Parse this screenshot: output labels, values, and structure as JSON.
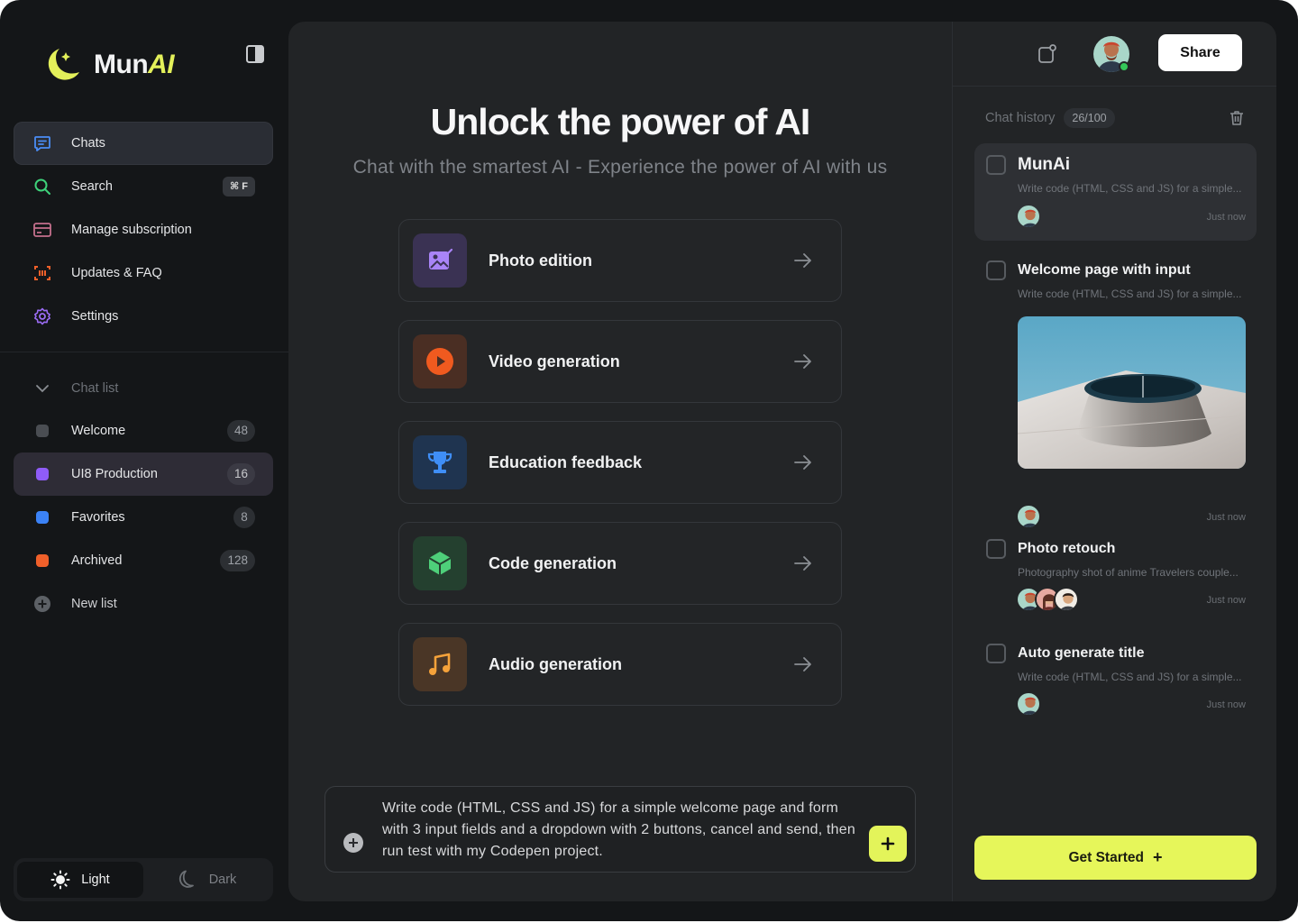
{
  "brand": {
    "name": "Mun",
    "name_accent": "AI"
  },
  "nav": {
    "items": [
      {
        "label": "Chats",
        "icon": "chat-icon",
        "active": true
      },
      {
        "label": "Search",
        "icon": "search-icon",
        "shortcut": "⌘ F"
      },
      {
        "label": "Manage subscription",
        "icon": "card-icon"
      },
      {
        "label": "Updates & FAQ",
        "icon": "scan-icon"
      },
      {
        "label": "Settings",
        "icon": "gear-icon"
      }
    ]
  },
  "lists": {
    "header": "Chat list",
    "items": [
      {
        "label": "Welcome",
        "count": "48",
        "color": "#4a4d52"
      },
      {
        "label": "UI8 Production",
        "count": "16",
        "color": "#8f5cf7",
        "active": true
      },
      {
        "label": "Favorites",
        "count": "8",
        "color": "#3b82f6"
      },
      {
        "label": "Archived",
        "count": "128",
        "color": "#f0602a"
      }
    ],
    "new_list": "New list"
  },
  "theme": {
    "light": "Light",
    "dark": "Dark",
    "selected": "Light"
  },
  "hero": {
    "title": "Unlock the power of AI",
    "subtitle": "Chat with the smartest AI - Experience the power of AI with us"
  },
  "cards": [
    {
      "label": "Photo edition",
      "icon": "photo-edit-icon",
      "bg": "#3a3253",
      "fg": "#a984f7"
    },
    {
      "label": "Video generation",
      "icon": "play-icon",
      "bg": "#4a2e23",
      "fg": "#f05a1f"
    },
    {
      "label": "Education feedback",
      "icon": "trophy-icon",
      "bg": "#1f3450",
      "fg": "#3f8ef7"
    },
    {
      "label": "Code generation",
      "icon": "cube-icon",
      "bg": "#24402f",
      "fg": "#4ed07a"
    },
    {
      "label": "Audio generation",
      "icon": "music-icon",
      "bg": "#4a3626",
      "fg": "#f5a23a"
    }
  ],
  "composer": {
    "text": "Write code (HTML, CSS and JS) for a simple welcome page and form with 3 input fields and a dropdown with 2 buttons, cancel and send, then run test with my Codepen project."
  },
  "topbar": {
    "share": "Share"
  },
  "history": {
    "label": "Chat history",
    "count": "26/100",
    "items": [
      {
        "title": "MunAi",
        "desc": "Write code (HTML, CSS and JS) for a simple...",
        "time": "Just now",
        "active": true
      },
      {
        "title": "Welcome page with input",
        "desc": "Write code (HTML, CSS and JS) for a simple...",
        "time": "Just now",
        "has_image": true
      },
      {
        "title": "Photo retouch",
        "desc": "Photography shot of anime Travelers couple...",
        "time": "Just now"
      },
      {
        "title": "Auto generate title",
        "desc": "Write code (HTML, CSS and JS) for a simple...",
        "time": "Just now"
      }
    ]
  },
  "cta": {
    "label": "Get Started",
    "plus": "+"
  }
}
